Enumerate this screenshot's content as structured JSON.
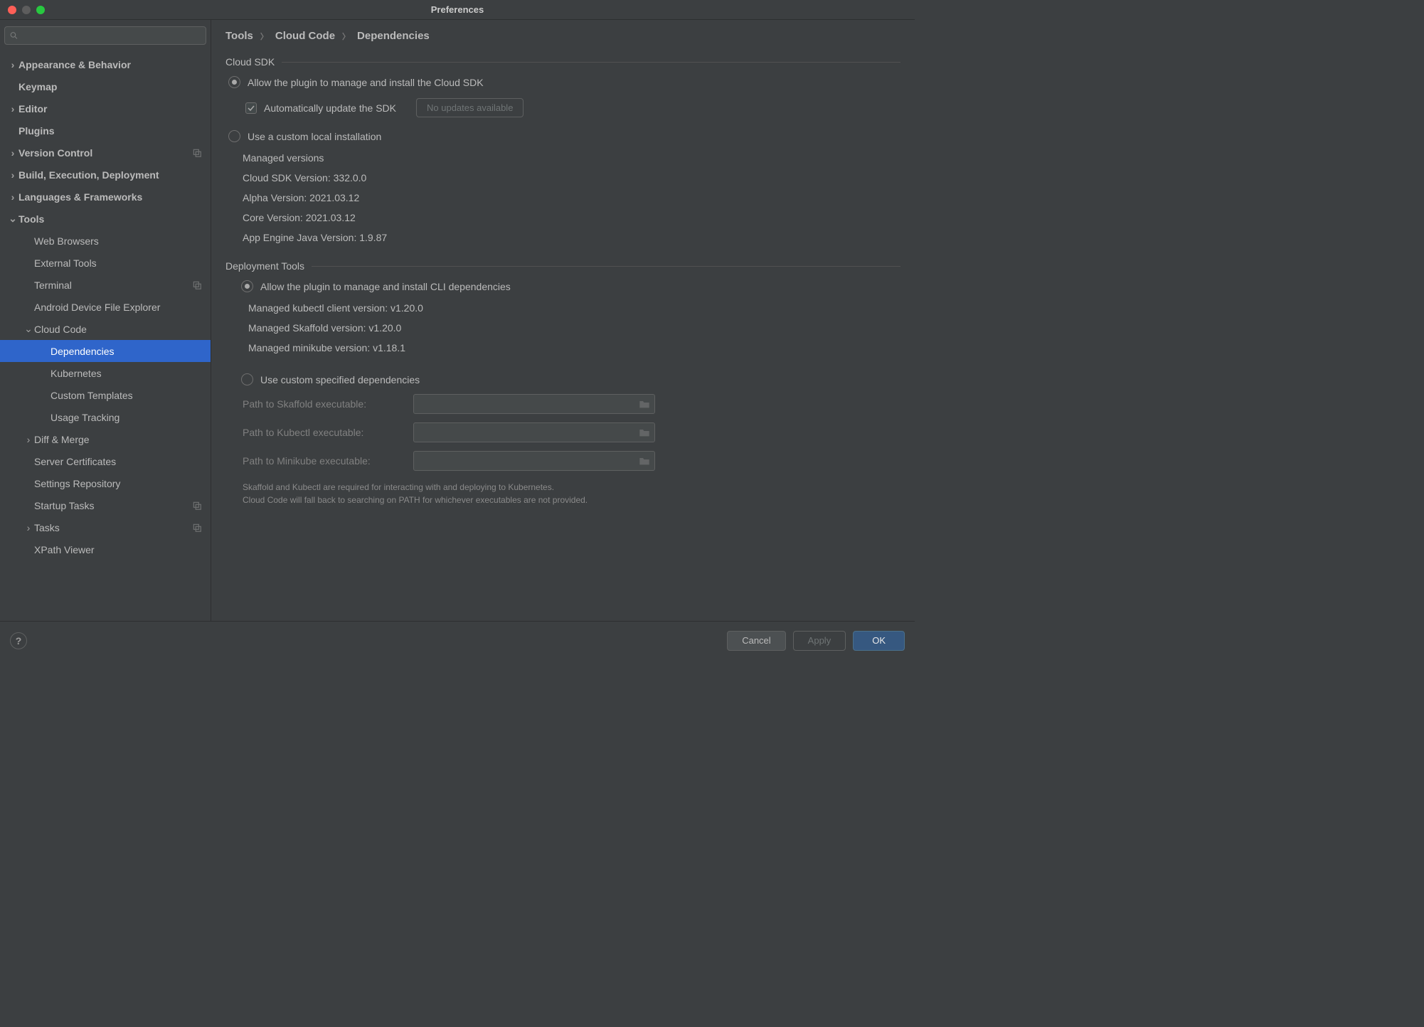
{
  "window": {
    "title": "Preferences"
  },
  "search": {
    "placeholder": ""
  },
  "sidebar": {
    "items": [
      {
        "label": "Appearance & Behavior",
        "bold": true,
        "expandable": true,
        "expanded": false,
        "depth": 0
      },
      {
        "label": "Keymap",
        "bold": true,
        "leaf": true,
        "depth": 0
      },
      {
        "label": "Editor",
        "bold": true,
        "expandable": true,
        "expanded": false,
        "depth": 0
      },
      {
        "label": "Plugins",
        "bold": true,
        "leaf": true,
        "depth": 0
      },
      {
        "label": "Version Control",
        "bold": true,
        "expandable": true,
        "expanded": false,
        "depth": 0,
        "tag": true
      },
      {
        "label": "Build, Execution, Deployment",
        "bold": true,
        "expandable": true,
        "expanded": false,
        "depth": 0
      },
      {
        "label": "Languages & Frameworks",
        "bold": true,
        "expandable": true,
        "expanded": false,
        "depth": 0
      },
      {
        "label": "Tools",
        "bold": true,
        "expandable": true,
        "expanded": true,
        "depth": 0
      },
      {
        "label": "Web Browsers",
        "leaf": true,
        "depth": 1
      },
      {
        "label": "External Tools",
        "leaf": true,
        "depth": 1
      },
      {
        "label": "Terminal",
        "leaf": true,
        "depth": 1,
        "tag": true
      },
      {
        "label": "Android Device File Explorer",
        "leaf": true,
        "depth": 1
      },
      {
        "label": "Cloud Code",
        "expandable": true,
        "expanded": true,
        "depth": 1
      },
      {
        "label": "Dependencies",
        "leaf": true,
        "depth": 2,
        "selected": true
      },
      {
        "label": "Kubernetes",
        "leaf": true,
        "depth": 2
      },
      {
        "label": "Custom Templates",
        "leaf": true,
        "depth": 2
      },
      {
        "label": "Usage Tracking",
        "leaf": true,
        "depth": 2
      },
      {
        "label": "Diff & Merge",
        "expandable": true,
        "expanded": false,
        "depth": 1
      },
      {
        "label": "Server Certificates",
        "leaf": true,
        "depth": 1
      },
      {
        "label": "Settings Repository",
        "leaf": true,
        "depth": 1
      },
      {
        "label": "Startup Tasks",
        "leaf": true,
        "depth": 1,
        "tag": true
      },
      {
        "label": "Tasks",
        "expandable": true,
        "expanded": false,
        "depth": 1,
        "tag": true
      },
      {
        "label": "XPath Viewer",
        "leaf": true,
        "depth": 1
      }
    ]
  },
  "breadcrumb": {
    "a": "Tools",
    "b": "Cloud Code",
    "c": "Dependencies"
  },
  "cloud_sdk": {
    "header": "Cloud SDK",
    "option_managed": "Allow the plugin to manage and install the Cloud SDK",
    "auto_update": "Automatically update the SDK",
    "no_updates": "No updates available",
    "option_custom": "Use a custom local installation",
    "managed_versions_label": "Managed versions",
    "sdk_version": "Cloud SDK Version: 332.0.0",
    "alpha_version": "Alpha Version: 2021.03.12",
    "core_version": "Core Version: 2021.03.12",
    "appengine_version": "App Engine Java Version: 1.9.87"
  },
  "deployment": {
    "header": "Deployment Tools",
    "option_managed": "Allow the plugin to manage and install CLI dependencies",
    "kubectl": "Managed kubectl client version: v1.20.0",
    "skaffold": "Managed Skaffold version: v1.20.0",
    "minikube": "Managed minikube version: v1.18.1",
    "option_custom": "Use custom specified dependencies",
    "path_skaffold_label": "Path to Skaffold executable:",
    "path_kubectl_label": "Path to Kubectl executable:",
    "path_minikube_label": "Path to Minikube executable:",
    "hint1": "Skaffold and Kubectl are required for interacting with and deploying to Kubernetes.",
    "hint2": "Cloud Code will fall back to searching on PATH for whichever executables are not provided."
  },
  "footer": {
    "cancel": "Cancel",
    "apply": "Apply",
    "ok": "OK"
  }
}
